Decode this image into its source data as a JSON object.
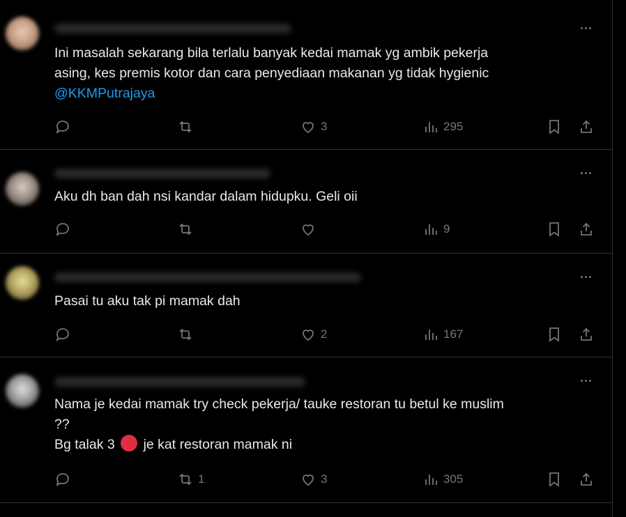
{
  "tweets": [
    {
      "text_lines": [
        "Ini masalah sekarang bila terlalu banyak kedai mamak yg ambik pekerja",
        "asing, kes premis kotor dan cara penyediaan makanan yg tidak hygienic"
      ],
      "mention": "@KKMPutrajaya",
      "reply_count": "",
      "retweet_count": "",
      "like_count": "3",
      "view_count": "295"
    },
    {
      "text_lines": [
        "Aku dh ban dah nsi kandar dalam hidupku. Geli oii"
      ],
      "reply_count": "",
      "retweet_count": "",
      "like_count": "",
      "view_count": "9"
    },
    {
      "text_lines": [
        "Pasai tu aku tak pi mamak dah"
      ],
      "reply_count": "",
      "retweet_count": "",
      "like_count": "2",
      "view_count": "167"
    },
    {
      "text_lines": [
        "Nama je kedai mamak try check pekerja/ tauke restoran tu betul ke muslim",
        "??"
      ],
      "last_line_before": "Bg talak 3",
      "last_line_after": "je kat restoran mamak ni",
      "reply_count": "",
      "retweet_count": "1",
      "like_count": "3",
      "view_count": "305"
    }
  ],
  "icons": {
    "reply": "reply-icon",
    "retweet": "retweet-icon",
    "like": "heart-icon",
    "views": "views-chart-icon",
    "bookmark": "bookmark-icon",
    "share": "share-icon",
    "more": "more-dots-icon",
    "emoji": "red-circle-emoji"
  },
  "colors": {
    "background": "#000000",
    "text": "#e7e9ea",
    "muted": "#71767b",
    "mention": "#1d9bf0",
    "border": "#2f3336",
    "emoji_red": "#dd2e44"
  }
}
